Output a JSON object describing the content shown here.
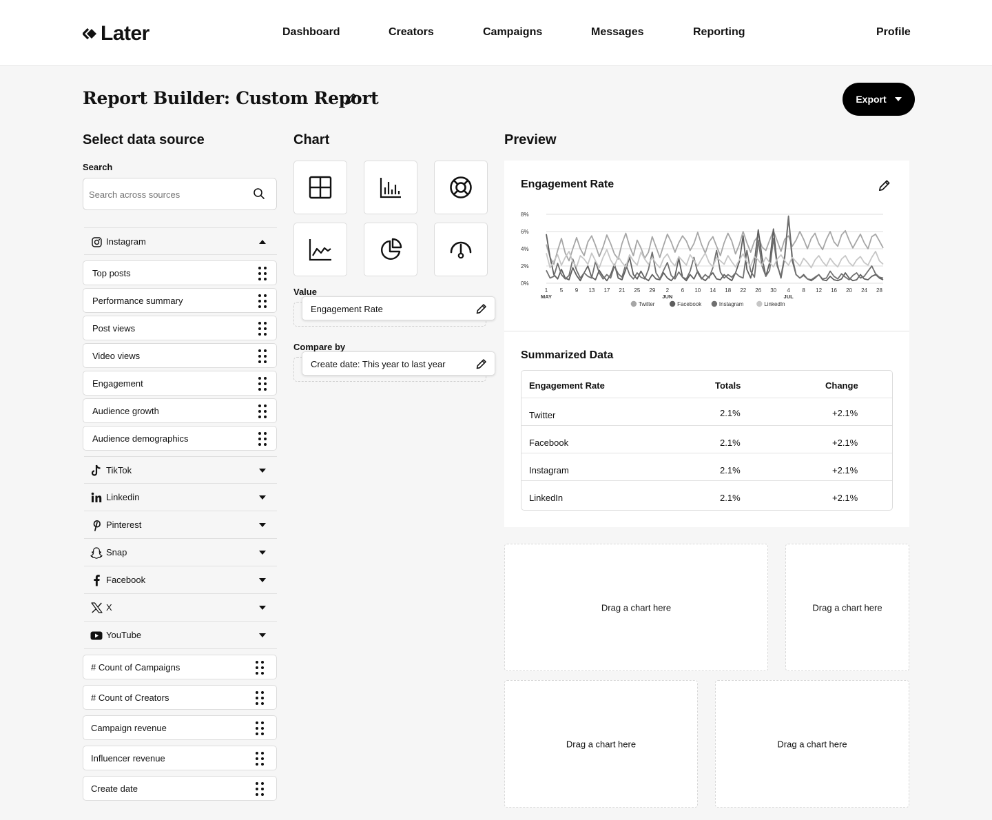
{
  "brand": {
    "name": "Later"
  },
  "nav": {
    "dashboard": "Dashboard",
    "creators": "Creators",
    "campaigns": "Campaigns",
    "messages": "Messages",
    "reporting": "Reporting",
    "profile": "Profile"
  },
  "header": {
    "title": "Report Builder: Custom Report",
    "export_label": "Export"
  },
  "data_source": {
    "heading": "Select data source",
    "search_label": "Search",
    "search_placeholder": "Search across sources",
    "sources": [
      {
        "label": "Instagram",
        "icon": "instagram-icon",
        "expanded": true,
        "items": [
          "Top posts",
          "Performance summary",
          "Post views",
          "Video views",
          "Engagement",
          "Audience growth",
          "Audience demographics"
        ]
      },
      {
        "label": "TikTok",
        "icon": "tiktok-icon"
      },
      {
        "label": "Linkedin",
        "icon": "linkedin-icon"
      },
      {
        "label": "Pinterest",
        "icon": "pinterest-icon"
      },
      {
        "label": "Snap",
        "icon": "snapchat-icon"
      },
      {
        "label": "Facebook",
        "icon": "facebook-icon"
      },
      {
        "label": "X",
        "icon": "x-icon"
      },
      {
        "label": "YouTube",
        "icon": "youtube-icon"
      }
    ],
    "metrics": [
      "# Count of Campaigns",
      "# Count of Creators",
      "Campaign revenue",
      "Influencer revenue",
      "Create date"
    ]
  },
  "chart_panel": {
    "heading": "Chart",
    "types": [
      "table-chart-icon",
      "bar-chart-icon",
      "donut-chart-icon",
      "line-chart-icon",
      "pie-chart-icon",
      "gauge-chart-icon"
    ],
    "value_label": "Value",
    "value": "Engagement Rate",
    "compare_label": "Compare by",
    "compare_value": "Create date: This year to last year"
  },
  "preview": {
    "heading": "Preview",
    "chart_title": "Engagement Rate",
    "summary_title": "Summarized Data",
    "table": {
      "headers": [
        "Engagement Rate",
        "Totals",
        "Change"
      ],
      "rows": [
        [
          "Twitter",
          "2.1%",
          "+2.1%"
        ],
        [
          "Facebook",
          "2.1%",
          "+2.1%"
        ],
        [
          "Instagram",
          "2.1%",
          "+2.1%"
        ],
        [
          "LinkedIn",
          "2.1%",
          "+2.1%"
        ]
      ]
    },
    "drop_placeholder": "Drag a chart here"
  },
  "chart_data": {
    "type": "line",
    "yticks": [
      "0%",
      "2%",
      "4%",
      "6%",
      "8%"
    ],
    "ylim": [
      0,
      8
    ],
    "x": [
      1,
      2,
      3,
      4,
      5,
      6,
      7,
      8,
      9,
      10,
      11,
      12,
      13,
      14,
      15,
      16,
      17,
      18,
      19,
      20,
      21,
      22,
      23,
      24,
      25,
      26,
      27,
      28,
      29,
      30,
      31,
      32,
      33,
      34,
      35,
      36,
      37,
      38,
      39,
      40,
      41,
      42,
      43,
      44,
      45,
      46,
      47,
      48,
      49,
      50,
      51,
      52,
      53,
      54,
      55,
      56,
      57,
      58,
      59,
      60,
      61,
      62,
      63,
      64,
      65,
      66,
      67,
      68,
      69,
      70,
      71,
      72,
      73,
      74,
      75,
      76,
      77,
      78,
      79,
      80,
      81,
      82,
      83,
      84,
      85,
      86,
      87,
      88,
      89,
      90
    ],
    "xticks": [
      {
        "x": 1,
        "label": "1",
        "month": "MAY"
      },
      {
        "x": 5,
        "label": "5"
      },
      {
        "x": 9,
        "label": "9"
      },
      {
        "x": 13,
        "label": "13"
      },
      {
        "x": 17,
        "label": "17"
      },
      {
        "x": 21,
        "label": "21"
      },
      {
        "x": 25,
        "label": "25"
      },
      {
        "x": 29,
        "label": "29"
      },
      {
        "x": 33,
        "label": "2",
        "month": "JUN"
      },
      {
        "x": 37,
        "label": "6"
      },
      {
        "x": 41,
        "label": "10"
      },
      {
        "x": 45,
        "label": "14"
      },
      {
        "x": 49,
        "label": "18"
      },
      {
        "x": 53,
        "label": "22"
      },
      {
        "x": 57,
        "label": "26"
      },
      {
        "x": 61,
        "label": "30"
      },
      {
        "x": 65,
        "label": "4",
        "month": "JUL"
      },
      {
        "x": 69,
        "label": "8"
      },
      {
        "x": 73,
        "label": "12"
      },
      {
        "x": 77,
        "label": "16"
      },
      {
        "x": 81,
        "label": "20"
      },
      {
        "x": 85,
        "label": "24"
      },
      {
        "x": 89,
        "label": "28"
      }
    ],
    "grid": true,
    "legend_position": "bottom",
    "series": [
      {
        "name": "Twitter",
        "color": "#a6a6a6",
        "values": [
          4.5,
          3.0,
          2.2,
          3.8,
          5.2,
          3.5,
          2.6,
          4.0,
          5.3,
          4.0,
          3.2,
          4.8,
          5.5,
          4.4,
          3.1,
          4.2,
          5.6,
          4.6,
          3.4,
          2.8,
          4.6,
          5.8,
          4.3,
          3.2,
          5.0,
          4.1,
          2.9,
          3.6,
          5.4,
          4.2,
          3.0,
          4.4,
          5.7,
          4.8,
          3.6,
          4.7,
          5.5,
          4.9,
          3.8,
          4.6,
          5.9,
          4.5,
          3.5,
          4.8,
          5.4,
          4.3,
          3.2,
          4.7,
          5.8,
          4.9,
          3.4,
          4.5,
          6.0,
          4.7,
          3.6,
          4.9,
          5.5,
          4.2,
          3.8,
          5.0,
          6.1,
          4.9,
          3.7,
          5.1,
          5.5,
          4.3,
          5.0,
          6.0,
          5.1,
          4.0,
          5.2,
          5.8,
          4.6,
          3.9,
          5.1,
          6.0,
          4.8,
          4.3,
          5.6,
          6.1,
          5.0,
          4.1,
          4.9,
          5.7,
          4.7,
          4.0,
          5.4,
          5.7,
          4.9,
          4.1
        ]
      },
      {
        "name": "Facebook",
        "color": "#5e5e5e",
        "values": [
          5.7,
          3.0,
          1.0,
          0.5,
          1.6,
          0.6,
          0.4,
          1.8,
          0.9,
          0.3,
          1.2,
          2.0,
          0.7,
          0.4,
          1.5,
          0.8,
          0.3,
          1.0,
          2.2,
          0.6,
          0.4,
          1.6,
          3.0,
          1.0,
          0.5,
          1.4,
          0.6,
          0.3,
          1.0,
          0.5,
          0.4,
          1.2,
          0.6,
          0.3,
          0.8,
          2.9,
          0.7,
          0.3,
          1.0,
          0.5,
          1.4,
          0.6,
          0.3,
          0.8,
          1.2,
          0.5,
          0.4,
          1.0,
          0.6,
          0.3,
          1.2,
          2.5,
          5.5,
          1.6,
          0.6,
          2.5,
          6.2,
          3.0,
          0.8,
          2.4,
          6.3,
          2.2,
          0.6,
          3.0,
          7.6,
          2.6,
          1.0,
          0.6,
          1.0,
          0.5,
          0.3,
          0.6,
          1.0,
          0.4,
          0.3,
          0.8,
          0.4,
          0.3,
          0.5,
          1.2,
          0.6,
          0.3,
          0.4,
          1.0,
          0.5,
          0.4,
          0.8,
          1.0,
          0.6,
          0.4
        ]
      },
      {
        "name": "Instagram",
        "color": "#707070",
        "values": [
          1.5,
          0.6,
          0.8,
          2.3,
          1.0,
          0.5,
          0.9,
          2.8,
          1.5,
          0.6,
          1.2,
          0.8,
          0.6,
          2.5,
          1.2,
          0.5,
          1.0,
          0.6,
          2.0,
          1.1,
          0.7,
          2.2,
          1.0,
          0.5,
          1.2,
          0.7,
          0.5,
          1.6,
          3.6,
          1.2,
          0.5,
          1.5,
          2.4,
          0.9,
          0.5,
          1.3,
          0.7,
          0.5,
          1.4,
          3.0,
          1.2,
          0.5,
          1.0,
          0.6,
          1.8,
          3.8,
          1.3,
          0.6,
          1.0,
          0.7,
          1.2,
          0.8,
          0.6,
          3.8,
          1.4,
          0.7,
          5.0,
          2.0,
          0.8,
          1.5,
          5.2,
          2.0,
          0.8,
          3.2,
          7.8,
          3.0,
          1.0,
          0.6,
          0.9,
          0.5,
          0.4,
          0.7,
          1.0,
          0.5,
          0.6,
          1.4,
          0.8,
          0.5,
          1.1,
          0.7,
          0.4,
          0.9,
          1.2,
          0.6,
          0.8,
          1.4,
          2.0,
          1.1,
          0.7,
          0.6
        ]
      },
      {
        "name": "LinkedIn",
        "color": "#c6c6c6",
        "values": [
          3.5,
          1.8,
          2.6,
          3.3,
          2.1,
          3.0,
          3.7,
          2.5,
          1.9,
          3.2,
          2.8,
          2.2,
          3.5,
          2.6,
          1.8,
          3.0,
          3.9,
          2.7,
          2.0,
          3.1,
          2.4,
          1.9,
          3.3,
          2.6,
          2.1,
          3.6,
          2.8,
          2.2,
          3.0,
          2.3,
          1.8,
          2.9,
          3.4,
          2.5,
          2.0,
          3.1,
          2.6,
          2.1,
          3.3,
          2.7,
          2.0,
          2.8,
          3.5,
          2.4,
          1.9,
          3.0,
          2.6,
          2.2,
          3.2,
          2.5,
          1.9,
          2.7,
          3.4,
          2.5,
          2.0,
          3.1,
          2.7,
          2.1,
          3.0,
          2.4,
          1.9,
          2.8,
          3.3,
          2.6,
          2.1,
          3.0,
          2.5,
          2.0,
          2.9,
          2.4,
          1.8,
          2.7,
          3.2,
          2.5,
          2.0,
          2.9,
          2.3,
          1.9,
          2.8,
          3.2,
          2.4,
          2.0,
          2.7,
          3.1,
          2.4,
          2.1,
          3.0,
          3.7,
          2.6,
          2.2
        ]
      }
    ]
  }
}
